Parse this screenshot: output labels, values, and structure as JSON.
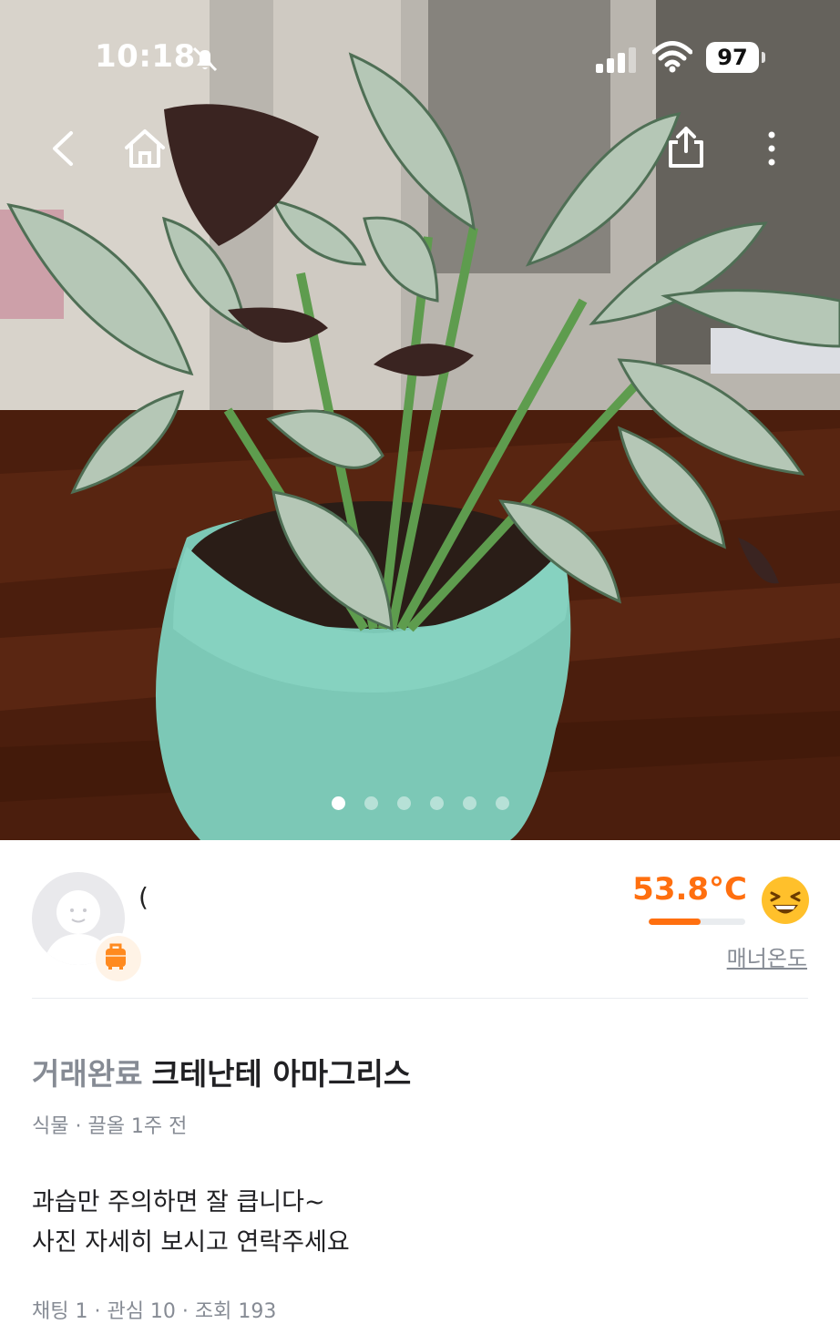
{
  "status_bar": {
    "time": "10:18",
    "battery": "97"
  },
  "nav": {
    "back_icon": "chevron-left-icon",
    "home_icon": "home-icon",
    "share_icon": "share-icon",
    "more_icon": "more-vertical-icon"
  },
  "carousel": {
    "total": 6,
    "current": 1
  },
  "seller": {
    "name": "(",
    "temperature": "53.8°C",
    "temperature_level": 0.538,
    "temperature_label": "매너온도",
    "accent": "#ff6f0f"
  },
  "post": {
    "status": "거래완료",
    "title": "크테난테 아마그리스",
    "meta": "식물 · 끌올 1주 전",
    "description_lines": [
      "과습만 주의하면 잘 큽니다~",
      "사진 자세히 보시고 연락주세요"
    ],
    "stats": "채팅 1 · 관심 10 · 조회 193"
  }
}
